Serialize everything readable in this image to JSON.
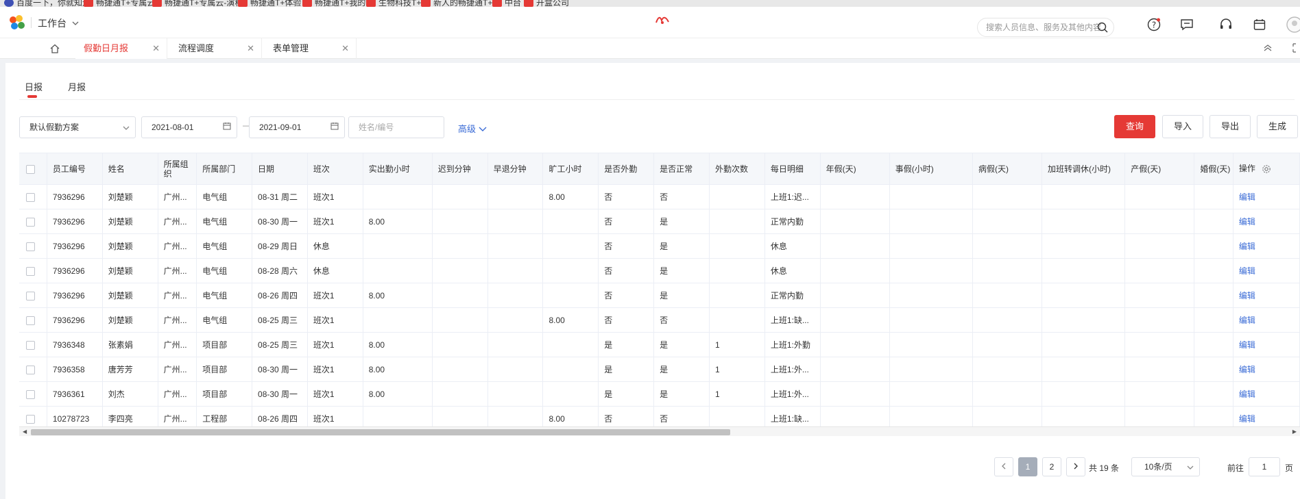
{
  "bookmarks": [
    "百度一下，你就知道",
    "畅捷通T+专属云",
    "畅捷通T+专属云-演程",
    "畅捷通T+体验",
    "畅捷通T+我的",
    "生物科技T+",
    "新人的畅捷通T+",
    "中台",
    "开盒公司"
  ],
  "header": {
    "workbench_label": "工作台",
    "search_placeholder": "搜索人员信息、服务及其他内容"
  },
  "tabs": [
    {
      "label": "假勤日月报",
      "active": true
    },
    {
      "label": "流程调度",
      "active": false
    },
    {
      "label": "表单管理",
      "active": false
    }
  ],
  "subtabs": [
    {
      "label": "日报",
      "active": true
    },
    {
      "label": "月报",
      "active": false
    }
  ],
  "filters": {
    "scheme": "默认假勤方案",
    "date_start": "2021-08-01",
    "date_end": "2021-09-01",
    "range_sep": "—",
    "name_placeholder": "姓名/编号",
    "advanced": "高级"
  },
  "actions": {
    "query": "查询",
    "import": "导入",
    "export": "导出",
    "generate": "生成"
  },
  "table": {
    "columns": [
      "员工编号",
      "姓名",
      "所属组织",
      "所属部门",
      "日期",
      "班次",
      "实出勤小时",
      "迟到分钟",
      "早退分钟",
      "旷工小时",
      "是否外勤",
      "是否正常",
      "外勤次数",
      "每日明细",
      "年假(天)",
      "事假(小时)",
      "病假(天)",
      "加班转调休(小时)",
      "产假(天)",
      "婚假(天)",
      "操作"
    ],
    "rows": [
      [
        "7936296",
        "刘楚颖",
        "广州...",
        "电气组",
        "08-31 周二",
        "班次1",
        "",
        "",
        "",
        "8.00",
        "否",
        "否",
        "",
        "上班1:迟...",
        "",
        "",
        "",
        "",
        "",
        "",
        "编辑"
      ],
      [
        "7936296",
        "刘楚颖",
        "广州...",
        "电气组",
        "08-30 周一",
        "班次1",
        "8.00",
        "",
        "",
        "",
        "否",
        "是",
        "",
        "正常内勤",
        "",
        "",
        "",
        "",
        "",
        "",
        "编辑"
      ],
      [
        "7936296",
        "刘楚颖",
        "广州...",
        "电气组",
        "08-29 周日",
        "休息",
        "",
        "",
        "",
        "",
        "否",
        "是",
        "",
        "休息",
        "",
        "",
        "",
        "",
        "",
        "",
        "编辑"
      ],
      [
        "7936296",
        "刘楚颖",
        "广州...",
        "电气组",
        "08-28 周六",
        "休息",
        "",
        "",
        "",
        "",
        "否",
        "是",
        "",
        "休息",
        "",
        "",
        "",
        "",
        "",
        "",
        "编辑"
      ],
      [
        "7936296",
        "刘楚颖",
        "广州...",
        "电气组",
        "08-26 周四",
        "班次1",
        "8.00",
        "",
        "",
        "",
        "否",
        "是",
        "",
        "正常内勤",
        "",
        "",
        "",
        "",
        "",
        "",
        "编辑"
      ],
      [
        "7936296",
        "刘楚颖",
        "广州...",
        "电气组",
        "08-25 周三",
        "班次1",
        "",
        "",
        "",
        "8.00",
        "否",
        "否",
        "",
        "上班1:缺...",
        "",
        "",
        "",
        "",
        "",
        "",
        "编辑"
      ],
      [
        "7936348",
        "张素娟",
        "广州...",
        "项目部",
        "08-25 周三",
        "班次1",
        "8.00",
        "",
        "",
        "",
        "是",
        "是",
        "1",
        "上班1:外勤",
        "",
        "",
        "",
        "",
        "",
        "",
        "编辑"
      ],
      [
        "7936358",
        "唐芳芳",
        "广州...",
        "项目部",
        "08-30 周一",
        "班次1",
        "8.00",
        "",
        "",
        "",
        "是",
        "是",
        "1",
        "上班1:外...",
        "",
        "",
        "",
        "",
        "",
        "",
        "编辑"
      ],
      [
        "7936361",
        "刘杰",
        "广州...",
        "项目部",
        "08-30 周一",
        "班次1",
        "8.00",
        "",
        "",
        "",
        "是",
        "是",
        "1",
        "上班1:外...",
        "",
        "",
        "",
        "",
        "",
        "",
        "编辑"
      ],
      [
        "10278723",
        "李四亮",
        "广州...",
        "工程部",
        "08-26 周四",
        "班次1",
        "",
        "",
        "",
        "8.00",
        "否",
        "否",
        "",
        "上班1:缺...",
        "",
        "",
        "",
        "",
        "",
        "",
        "编辑"
      ]
    ]
  },
  "pagination": {
    "pages": [
      "1",
      "2"
    ],
    "current": "1",
    "total": "共 19 条",
    "page_size": "10条/页",
    "goto_label": "前往",
    "goto_value": "1",
    "page_unit": "页"
  },
  "colors": {
    "accent": "#e53935",
    "link": "#3a6bd6"
  }
}
